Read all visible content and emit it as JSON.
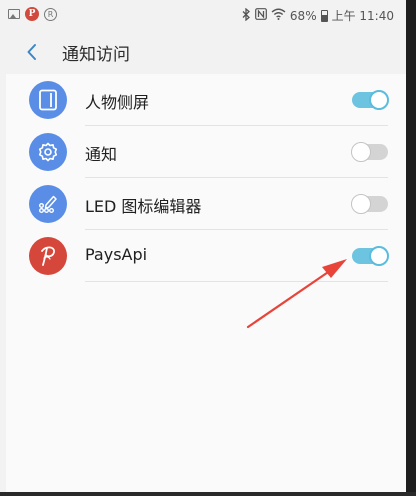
{
  "status_bar": {
    "time": "上午 11:40",
    "battery": "68%",
    "left_icons": [
      "image-icon",
      "pinterest-icon",
      "registered-icon"
    ],
    "right_icons": [
      "bluetooth-icon",
      "nfc-icon",
      "wifi-icon",
      "battery-icon"
    ]
  },
  "header": {
    "title": "通知访问",
    "back_icon": "chevron-left-icon"
  },
  "apps": [
    {
      "label": "人物侧屏",
      "icon": "people-edge-icon",
      "icon_color": "#5a8ee6",
      "enabled": true
    },
    {
      "label": "通知",
      "icon": "gear-icon",
      "icon_color": "#5a8ee6",
      "enabled": false
    },
    {
      "label": "LED 图标编辑器",
      "icon": "led-editor-icon",
      "icon_color": "#5a8ee6",
      "enabled": false
    },
    {
      "label": "PaysApi",
      "icon": "paysapi-logo-icon",
      "icon_color": "#d5473b",
      "enabled": true
    }
  ],
  "annotation": {
    "arrow_color": "#e8443a",
    "points_to": "paysapi-toggle"
  },
  "colors": {
    "toggle_on": "#6cc4e0",
    "toggle_off": "#d4d4d4",
    "back_arrow": "#3a86c7"
  }
}
